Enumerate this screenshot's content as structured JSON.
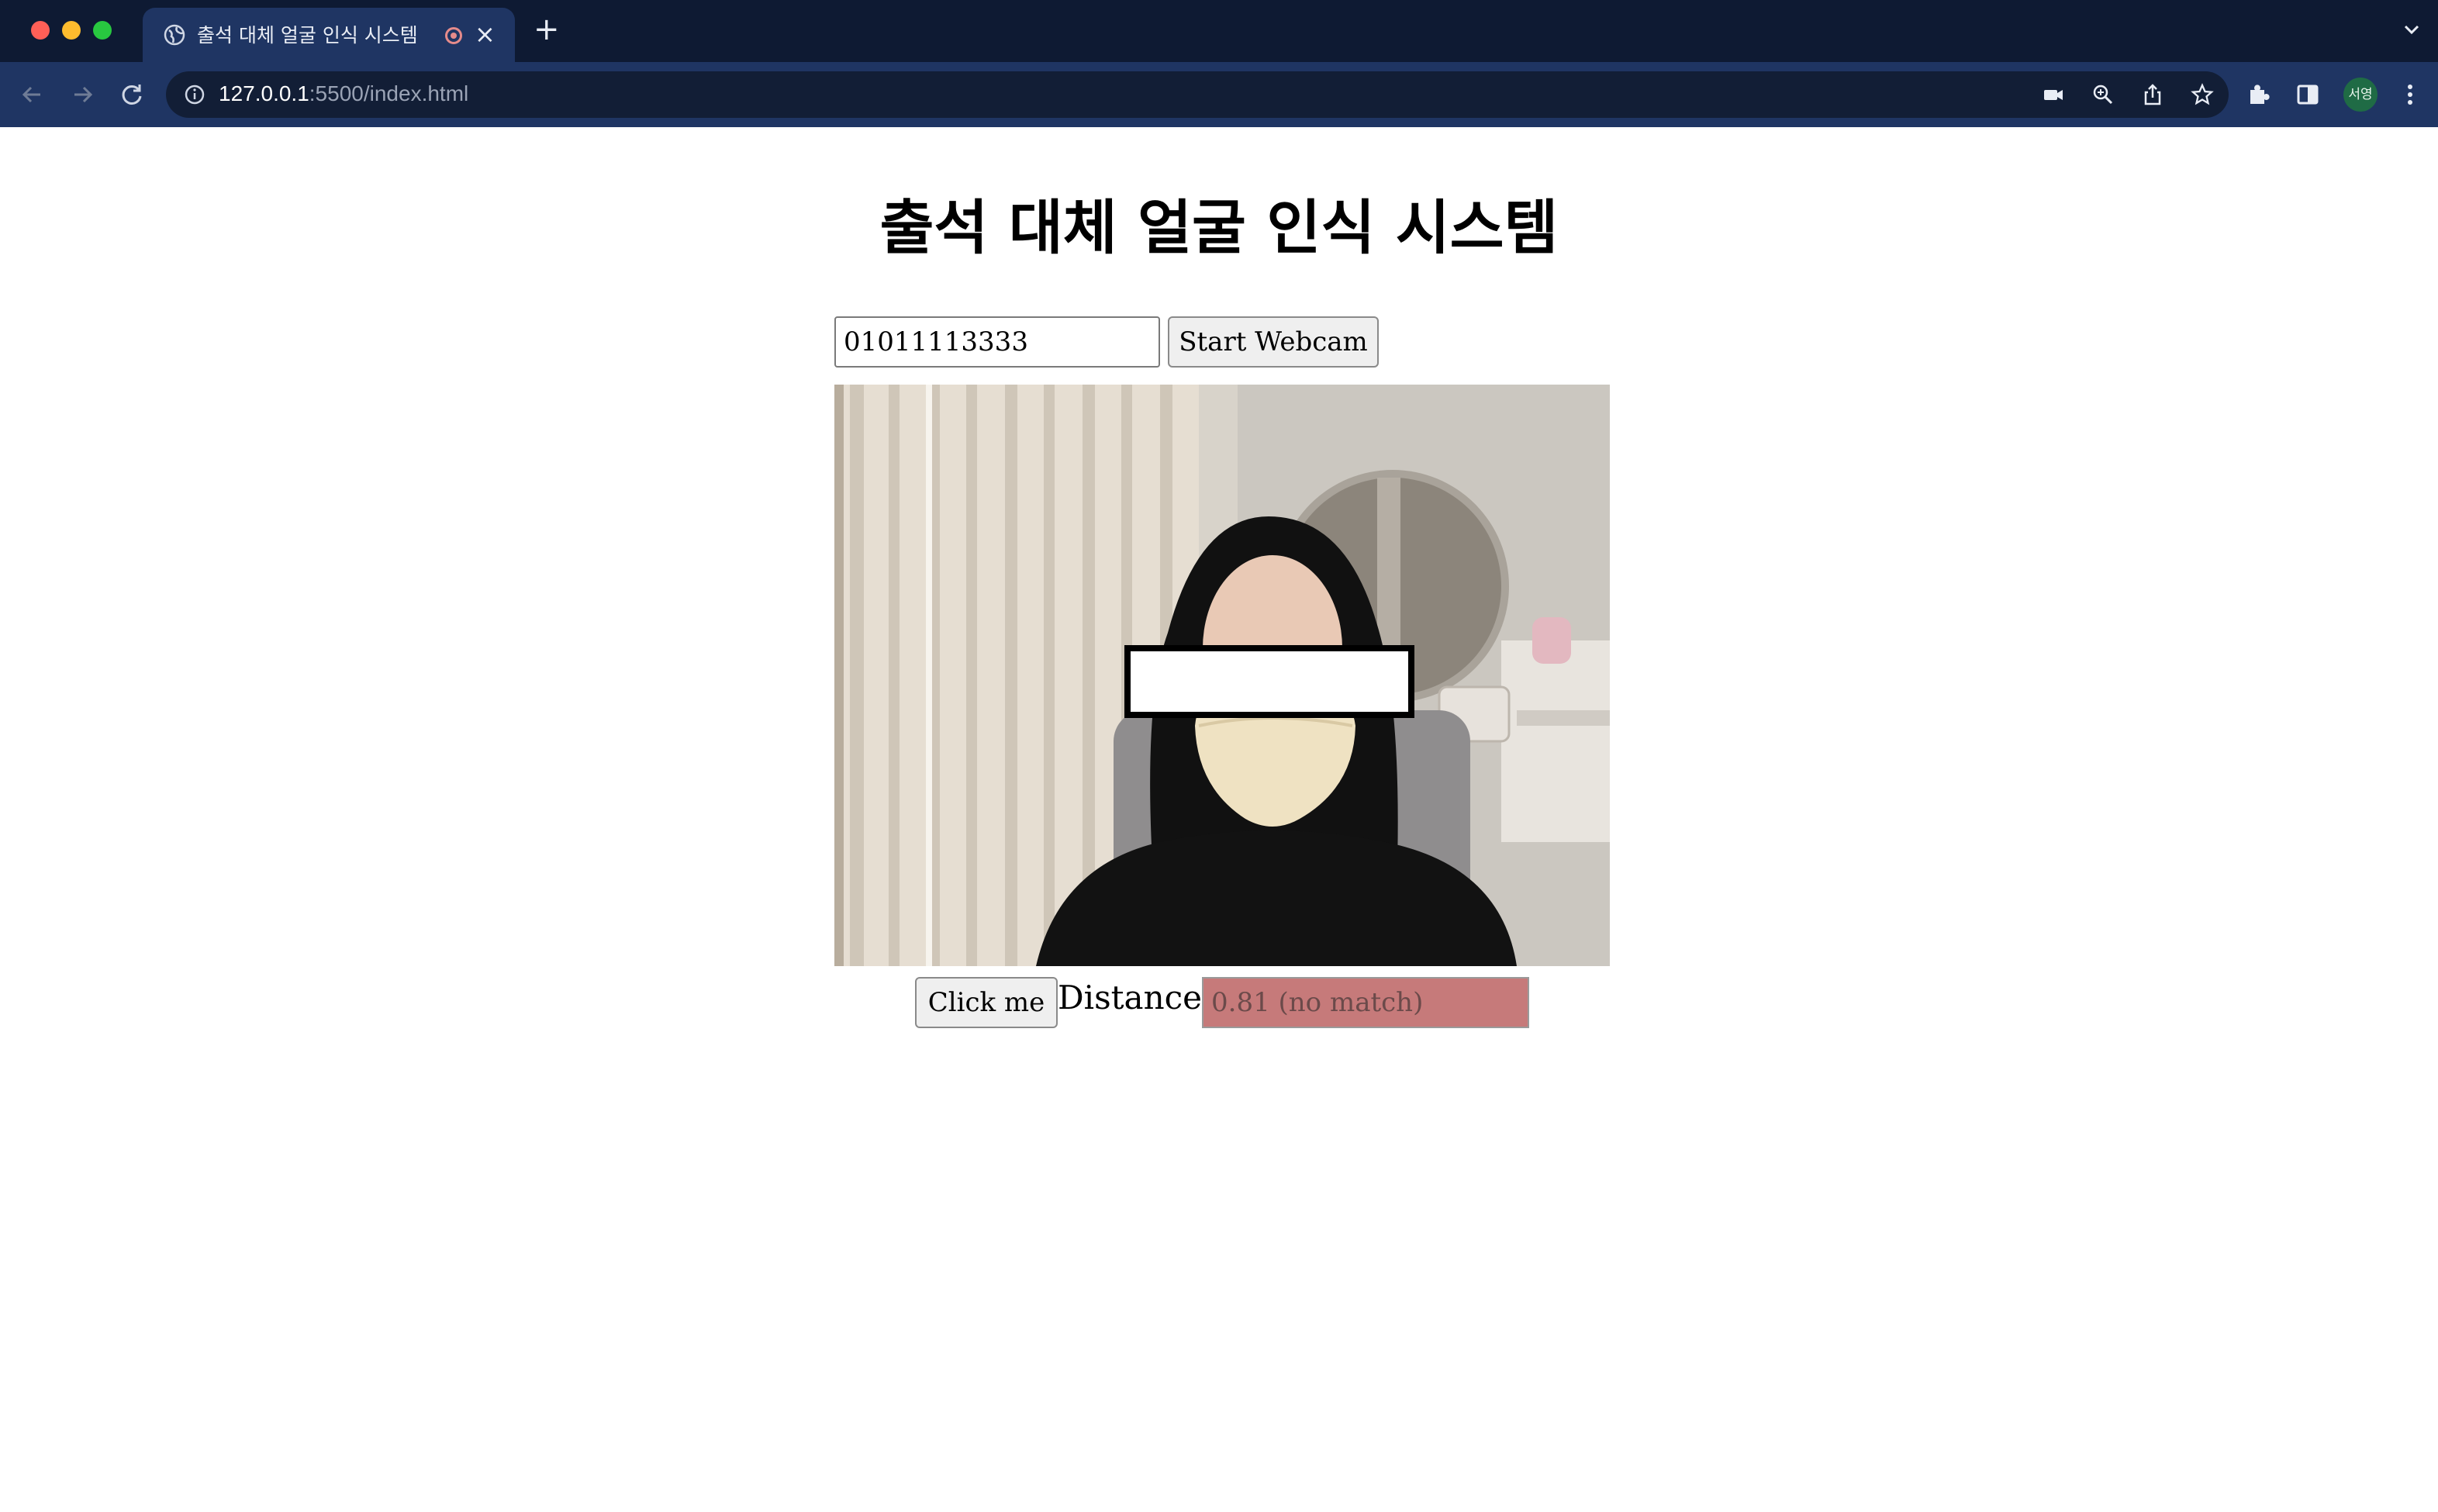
{
  "browser": {
    "tab": {
      "title": "출석 대체 얼굴 인식 시스템",
      "close_glyph": "×"
    },
    "new_tab_glyph": "+",
    "url": {
      "host": "127.0.0.1",
      "rest": ":5500/index.html"
    },
    "profile_initials": "서영"
  },
  "page": {
    "title": "출석 대체 얼굴 인식 시스템",
    "phone_input_value": "01011113333",
    "start_button_label": "Start Webcam",
    "click_button_label": "Click me",
    "distance_label": "Distance:",
    "distance_value": "0.81 (no match)"
  },
  "colors": {
    "chrome_dark": "#0e1a33",
    "chrome_tab": "#1f3563",
    "distance_no_match_bg": "#c67a7a",
    "avatar_bg": "#1f6b45"
  },
  "icons": [
    "globe-icon",
    "record-icon",
    "close-icon",
    "plus-icon",
    "chevron-down-icon",
    "back-arrow-icon",
    "forward-arrow-icon",
    "reload-icon",
    "info-icon",
    "camera-icon",
    "zoom-icon",
    "share-icon",
    "star-icon",
    "puzzle-icon",
    "sidepanel-icon",
    "kebab-menu-icon"
  ]
}
